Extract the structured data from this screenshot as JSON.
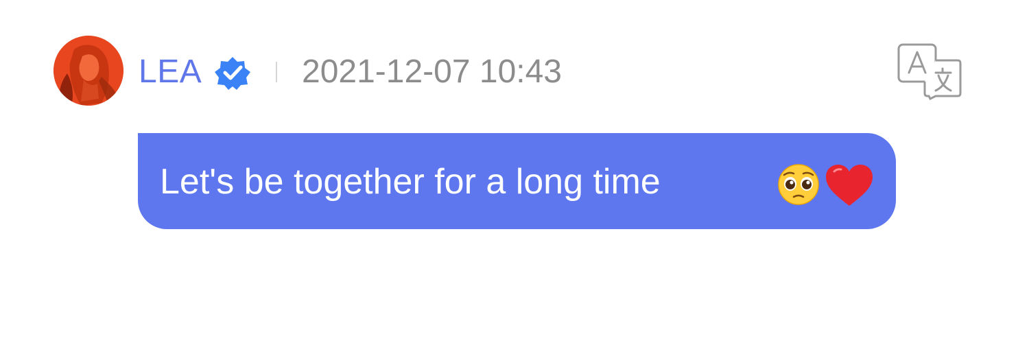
{
  "message": {
    "author": {
      "name": "LEA",
      "verified": true,
      "avatar_icon": "avatar-photo-icon"
    },
    "timestamp": "2021-12-07 10:43",
    "text": "Let's be together for a long time",
    "emojis": [
      "pleading-face-icon",
      "red-heart-icon"
    ],
    "translate_icon": "translate-icon"
  },
  "colors": {
    "username": "#5f77e8",
    "verified_badge": "#3b82f6",
    "timestamp": "#8c8c8c",
    "bubble_bg": "#5f77ee",
    "bubble_text": "#ffffff",
    "avatar_bg": "#e5431e"
  }
}
